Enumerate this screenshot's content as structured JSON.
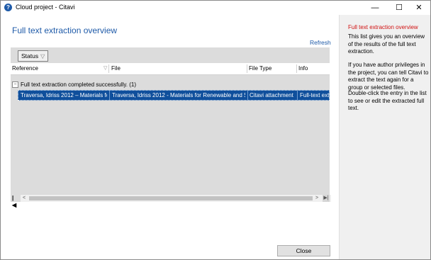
{
  "window": {
    "title": "Cloud project - Citavi",
    "icon": "citavi-logo-icon",
    "controls": {
      "minimize": "—",
      "maximize": "☐",
      "close": "✕"
    }
  },
  "main": {
    "heading": "Full text extraction overview",
    "refresh_label": "Refresh",
    "group_chip": {
      "label": "Status",
      "icon": "filter-icon"
    },
    "columns": [
      "Reference",
      "File",
      "File Type",
      "Info"
    ],
    "group": {
      "toggle": "−",
      "label": "Full text extraction completed successfully. (1)"
    },
    "rows": [
      {
        "reference": "Traversa, Idriss 2012 – Materials fo",
        "file": "Traversa, Idriss 2012 - Materials for Renewable and S",
        "file_type": "Citavi attachment",
        "info": "Full-text extr"
      }
    ],
    "scrollbar": {
      "left_arrow": "<",
      "right_arrow": ">",
      "end_button": "▶|",
      "start_marker": "|◀"
    },
    "close_label": "Close"
  },
  "help": {
    "title": "Full text extraction overview",
    "paragraphs": [
      "This list gives you an overview of the results of the full text extraction.",
      "If you have author privileges in the project, you can tell Citavi to extract the text again for a group or selected files.",
      "Double-click the entry in the list to see or edit the extracted full text."
    ]
  },
  "colors": {
    "accent": "#1e5aa8",
    "selection": "#0f4f9c",
    "help_title": "#d01010",
    "help_background": "#f0f0f0",
    "grid_background": "#dcdcdc"
  }
}
